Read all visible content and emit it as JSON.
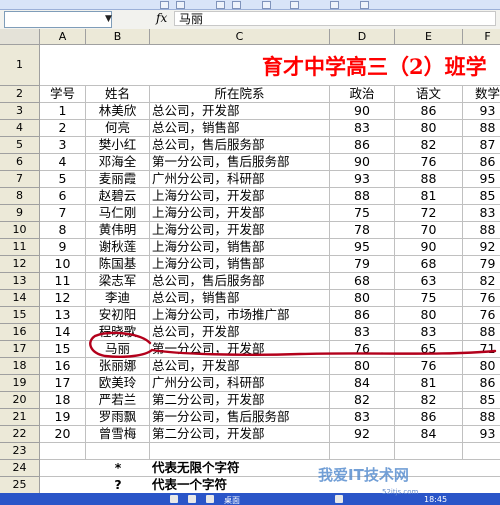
{
  "formula_bar": {
    "namebox_value": "",
    "fx_label": "fx",
    "content": "马丽"
  },
  "columns": [
    "A",
    "B",
    "C",
    "D",
    "E",
    "F"
  ],
  "title": "育才中学高三（2）班学",
  "headers": [
    "学号",
    "姓名",
    "所在院系",
    "政治",
    "语文",
    "数学"
  ],
  "rows": [
    {
      "row": "3",
      "id": "1",
      "name": "林美欣",
      "dept": "总公司，开发部",
      "zz": "90",
      "yw": "86",
      "sx": "93"
    },
    {
      "row": "4",
      "id": "2",
      "name": "何亮",
      "dept": "总公司，销售部",
      "zz": "83",
      "yw": "80",
      "sx": "88"
    },
    {
      "row": "5",
      "id": "3",
      "name": "樊小红",
      "dept": "总公司，售后服务部",
      "zz": "86",
      "yw": "82",
      "sx": "87"
    },
    {
      "row": "6",
      "id": "4",
      "name": "邓海全",
      "dept": "第一分公司，售后服务部",
      "zz": "90",
      "yw": "76",
      "sx": "86"
    },
    {
      "row": "7",
      "id": "5",
      "name": "麦丽霞",
      "dept": "广州分公司，科研部",
      "zz": "93",
      "yw": "88",
      "sx": "95"
    },
    {
      "row": "8",
      "id": "6",
      "name": "赵碧云",
      "dept": "上海分公司，开发部",
      "zz": "88",
      "yw": "81",
      "sx": "85"
    },
    {
      "row": "9",
      "id": "7",
      "name": "马仁刚",
      "dept": "上海分公司，开发部",
      "zz": "75",
      "yw": "72",
      "sx": "83"
    },
    {
      "row": "10",
      "id": "8",
      "name": "黄伟明",
      "dept": "上海分公司，开发部",
      "zz": "78",
      "yw": "70",
      "sx": "88"
    },
    {
      "row": "11",
      "id": "9",
      "name": "谢秋莲",
      "dept": "上海分公司，销售部",
      "zz": "95",
      "yw": "90",
      "sx": "92"
    },
    {
      "row": "12",
      "id": "10",
      "name": "陈国基",
      "dept": "上海分公司，销售部",
      "zz": "79",
      "yw": "68",
      "sx": "79"
    },
    {
      "row": "13",
      "id": "11",
      "name": "梁志军",
      "dept": "总公司，售后服务部",
      "zz": "68",
      "yw": "63",
      "sx": "82"
    },
    {
      "row": "14",
      "id": "12",
      "name": "李迪",
      "dept": "总公司，销售部",
      "zz": "80",
      "yw": "75",
      "sx": "76"
    },
    {
      "row": "15",
      "id": "13",
      "name": "安初阳",
      "dept": "上海分公司，市场推广部",
      "zz": "86",
      "yw": "80",
      "sx": "76"
    },
    {
      "row": "16",
      "id": "14",
      "name": "程晓歌",
      "dept": "总公司，开发部",
      "zz": "83",
      "yw": "83",
      "sx": "88"
    },
    {
      "row": "17",
      "id": "15",
      "name": "马丽",
      "dept": "第一分公司，开发部",
      "zz": "76",
      "yw": "65",
      "sx": "71"
    },
    {
      "row": "18",
      "id": "16",
      "name": "张丽娜",
      "dept": "总公司，开发部",
      "zz": "80",
      "yw": "76",
      "sx": "80"
    },
    {
      "row": "19",
      "id": "17",
      "name": "欧美玲",
      "dept": "广州分公司，科研部",
      "zz": "84",
      "yw": "81",
      "sx": "86"
    },
    {
      "row": "20",
      "id": "18",
      "name": "严若兰",
      "dept": "第二分公司，开发部",
      "zz": "82",
      "yw": "82",
      "sx": "85"
    },
    {
      "row": "21",
      "id": "19",
      "name": "罗雨飘",
      "dept": "第一分公司，售后服务部",
      "zz": "83",
      "yw": "86",
      "sx": "88"
    },
    {
      "row": "22",
      "id": "20",
      "name": "曾雪梅",
      "dept": "第二分公司，开发部",
      "zz": "92",
      "yw": "84",
      "sx": "93"
    }
  ],
  "notes": [
    {
      "row": "24",
      "symbol": "*",
      "text": "代表无限个字符"
    },
    {
      "row": "25",
      "symbol": "?",
      "text": "代表一个字符"
    }
  ],
  "empty_row": "23",
  "title_row": "1",
  "header_row": "2",
  "taskbar": {
    "desktop": "桌面",
    "time": "18:45"
  },
  "watermark": {
    "text": "我爱IT技术网",
    "url": "52itjs.com"
  },
  "colors": {
    "title": "#ff0000",
    "annotation": "#b3001b",
    "header_bg": "#ece9d8"
  }
}
